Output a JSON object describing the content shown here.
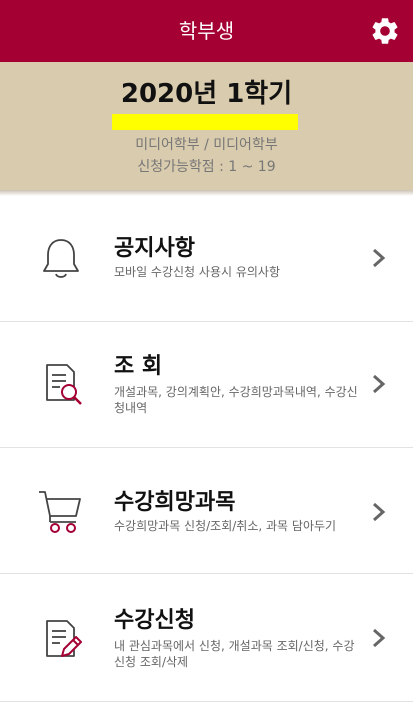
{
  "header": {
    "title": "학부생",
    "settings_icon": "gear-icon",
    "bg_color": "#a50034"
  },
  "semester": {
    "term": "2020년 1학기",
    "department": "미디어학부 / 미디어학부",
    "credits": "신청가능학점 : 1 ~ 19",
    "bg_color": "#d9cbad",
    "highlight_color": "#ffff00"
  },
  "menu": {
    "items": [
      {
        "title": "공지사항",
        "description": "모바일 수강신청 사용시 유의사항",
        "icon": "bell-icon"
      },
      {
        "title": "조   회",
        "description": "개설과목, 강의계획안, 수강희망과목내역, 수강신청내역",
        "icon": "document-search-icon"
      },
      {
        "title": "수강희망과목",
        "description": "수강희망과목 신청/조회/취소, 과목 담아두기",
        "icon": "cart-icon"
      },
      {
        "title": "수강신청",
        "description": "내 관심과목에서 신청, 개설과목 조회/신청, 수강신청 조회/삭제",
        "icon": "document-edit-icon"
      }
    ],
    "chevron_icon": "chevron-right-icon"
  }
}
